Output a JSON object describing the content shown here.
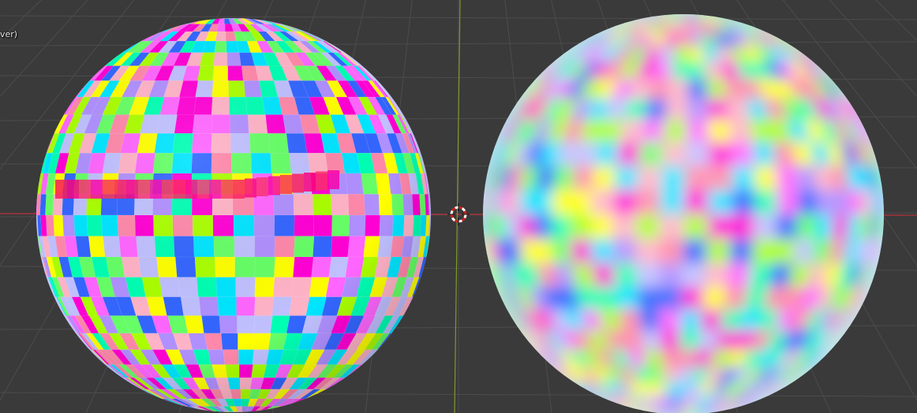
{
  "viewport": {
    "overlay_text": "ver)",
    "background_color": "#3a3a3a",
    "grid_color": "#4c4c4c",
    "x_axis_color": "#b8333c",
    "y_axis_color": "#7e9a2a",
    "cursor_icon": "3d-cursor-icon"
  },
  "objects": [
    {
      "name": "sphere-left",
      "texture": "uv-checker-grid-sharp",
      "palette": [
        "#ff00d4",
        "#00e5ff",
        "#ffff00",
        "#66ff66",
        "#b090ff",
        "#ff88aa",
        "#00ffb3",
        "#3366ff",
        "#ff66ff",
        "#aaff00",
        "#ffb3c6",
        "#c0c0ff"
      ]
    },
    {
      "name": "sphere-right",
      "texture": "uv-checker-grid-blurred",
      "palette": [
        "#ff00d4",
        "#00e5ff",
        "#ffff00",
        "#66ff66",
        "#b090ff",
        "#ff88aa",
        "#00ffb3",
        "#3366ff",
        "#ff66ff",
        "#aaff00",
        "#ffb3c6",
        "#c0c0ff"
      ]
    }
  ]
}
